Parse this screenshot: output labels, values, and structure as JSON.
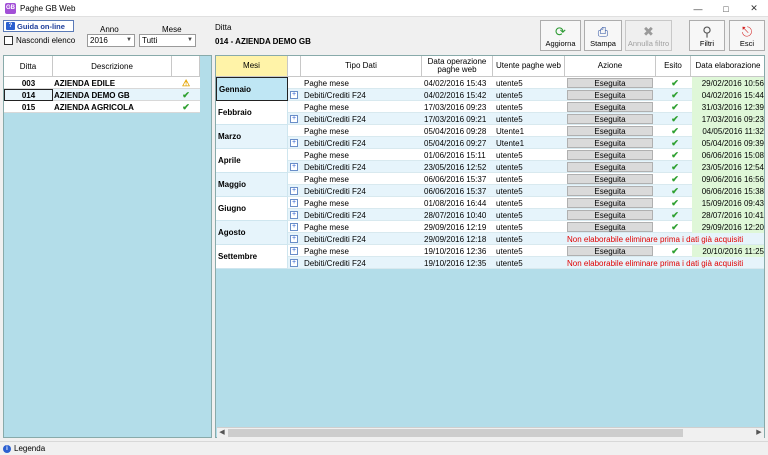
{
  "window": {
    "title": "Paghe GB Web",
    "icon_label": "GB"
  },
  "filters": {
    "guida_label": "Guida on-line",
    "nascondi_label": "Nascondi elenco",
    "anno_label": "Anno",
    "anno_value": "2016",
    "mese_label": "Mese",
    "mese_value": "Tutti",
    "ditta_label": "Ditta",
    "ditta_value": "014 - AZIENDA DEMO GB"
  },
  "toolbar": {
    "aggiorna": "Aggiorna",
    "stampa": "Stampa",
    "annulla_filtro": "Annulla filtro",
    "filtri": "Filtri",
    "esci": "Esci"
  },
  "ditte_table": {
    "headers": {
      "ditta": "Ditta",
      "descrizione": "Descrizione"
    },
    "rows": [
      {
        "code": "003",
        "name": "AZIENDA EDILE",
        "status": "warning-icon"
      },
      {
        "code": "014",
        "name": "AZIENDA DEMO GB",
        "status": "check-icon"
      },
      {
        "code": "015",
        "name": "AZIENDA AGRICOLA",
        "status": "check-icon"
      }
    ]
  },
  "mesi_table": {
    "headers": {
      "mesi": "Mesi",
      "tipo": "Tipo Dati",
      "data_op": "Data operazione paghe web",
      "utente": "Utente paghe web",
      "azione": "Azione",
      "esito": "Esito",
      "data_el": "Data elaborazione"
    },
    "months": [
      {
        "name": "Gennaio",
        "rows": [
          {
            "tipo": "Paghe mese",
            "data_op": "04/02/2016 15:43",
            "utente": "utente5",
            "azione": "Eseguita",
            "esito": "ok",
            "data_el": "29/02/2016 10:56"
          },
          {
            "tipo": "Debiti/Crediti F24",
            "data_op": "04/02/2016 15:42",
            "utente": "utente5",
            "azione": "Eseguita",
            "esito": "ok",
            "data_el": "04/02/2016 15:44"
          }
        ]
      },
      {
        "name": "Febbraio",
        "rows": [
          {
            "tipo": "Paghe mese",
            "data_op": "17/03/2016 09:23",
            "utente": "utente5",
            "azione": "Eseguita",
            "esito": "ok",
            "data_el": "31/03/2016 12:39"
          },
          {
            "tipo": "Debiti/Crediti F24",
            "data_op": "17/03/2016 09:21",
            "utente": "utente5",
            "azione": "Eseguita",
            "esito": "ok",
            "data_el": "17/03/2016 09:23"
          }
        ]
      },
      {
        "name": "Marzo",
        "rows": [
          {
            "tipo": "Paghe mese",
            "data_op": "05/04/2016 09:28",
            "utente": "Utente1",
            "azione": "Eseguita",
            "esito": "ok",
            "data_el": "04/05/2016 11:32"
          },
          {
            "tipo": "Debiti/Crediti F24",
            "data_op": "05/04/2016 09:27",
            "utente": "Utente1",
            "azione": "Eseguita",
            "esito": "ok",
            "data_el": "05/04/2016 09:39"
          }
        ]
      },
      {
        "name": "Aprile",
        "rows": [
          {
            "tipo": "Paghe mese",
            "data_op": "01/06/2016 15:11",
            "utente": "utente5",
            "azione": "Eseguita",
            "esito": "ok",
            "data_el": "06/06/2016 15:08"
          },
          {
            "tipo": "Debiti/Crediti F24",
            "data_op": "23/05/2016 12:52",
            "utente": "utente5",
            "azione": "Eseguita",
            "esito": "ok",
            "data_el": "23/05/2016 12:54"
          }
        ]
      },
      {
        "name": "Maggio",
        "rows": [
          {
            "tipo": "Paghe mese",
            "data_op": "06/06/2016 15:37",
            "utente": "utente5",
            "azione": "Eseguita",
            "esito": "ok",
            "data_el": "09/06/2016 16:56"
          },
          {
            "tipo": "Debiti/Crediti F24",
            "data_op": "06/06/2016 15:37",
            "utente": "utente5",
            "azione": "Eseguita",
            "esito": "ok",
            "data_el": "06/06/2016 15:38"
          }
        ]
      },
      {
        "name": "Giugno",
        "rows": [
          {
            "tipo": "Paghe mese",
            "data_op": "01/08/2016 16:44",
            "utente": "utente5",
            "azione": "Eseguita",
            "esito": "ok",
            "data_el": "15/09/2016 09:43"
          },
          {
            "tipo": "Debiti/Crediti F24",
            "data_op": "28/07/2016 10:40",
            "utente": "utente5",
            "azione": "Eseguita",
            "esito": "ok",
            "data_el": "28/07/2016 10:41"
          }
        ]
      },
      {
        "name": "Agosto",
        "rows": [
          {
            "tipo": "Paghe mese",
            "data_op": "29/09/2016 12:19",
            "utente": "utente5",
            "azione": "Eseguita",
            "esito": "ok",
            "data_el": "29/09/2016 12:20"
          },
          {
            "tipo": "Debiti/Crediti F24",
            "data_op": "29/09/2016 12:18",
            "utente": "utente5",
            "azione": "Non elaborabile eliminare prima i dati già acquisiti",
            "esito": "",
            "data_el": ""
          }
        ]
      },
      {
        "name": "Settembre",
        "rows": [
          {
            "tipo": "Paghe mese",
            "data_op": "19/10/2016 12:36",
            "utente": "utente5",
            "azione": "Eseguita",
            "esito": "ok",
            "data_el": "20/10/2016 11:25"
          },
          {
            "tipo": "Debiti/Crediti F24",
            "data_op": "19/10/2016 12:35",
            "utente": "utente5",
            "azione": "Non elaborabile eliminare prima i dati già acquisiti",
            "esito": "",
            "data_el": ""
          }
        ]
      }
    ]
  },
  "statusbar": {
    "legenda": "Legenda"
  }
}
